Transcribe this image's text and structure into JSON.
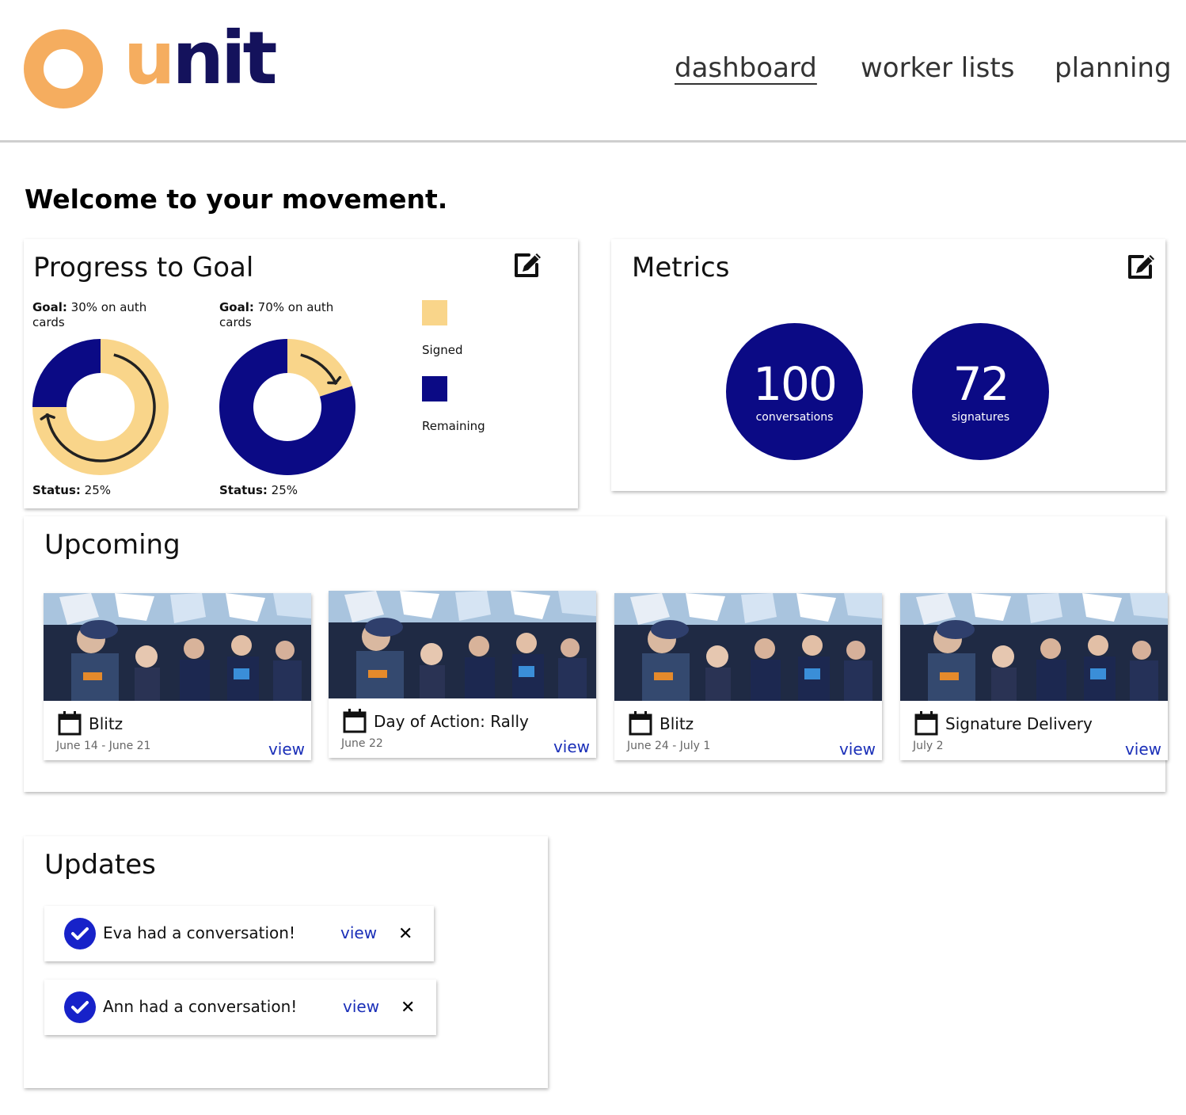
{
  "brand": {
    "name": "unit",
    "name_first": "u",
    "name_rest": "nit",
    "accent_color": "#f5ad5f",
    "navy_color": "#14125c"
  },
  "nav": {
    "items": [
      {
        "label": "dashboard",
        "active": true
      },
      {
        "label": "worker lists",
        "active": false
      },
      {
        "label": "planning",
        "active": false
      }
    ]
  },
  "welcome": "Welcome to your movement.",
  "progress": {
    "title": "Progress to Goal",
    "edit_icon": "edit-icon",
    "charts": [
      {
        "goal_label": "Goal:",
        "goal_text": "30% on auth",
        "goal_text2": "cards",
        "status_label": "Status:",
        "status_text": "25%",
        "signed_fraction": 0.75
      },
      {
        "goal_label": "Goal:",
        "goal_text": "70% on auth",
        "goal_text2": "cards",
        "status_label": "Status:",
        "status_text": "25%",
        "signed_fraction": 0.2
      }
    ],
    "legend": [
      {
        "label": "Signed",
        "color": "#f9d58a"
      },
      {
        "label": "Remaining",
        "color": "#0b0a85"
      }
    ]
  },
  "metrics": {
    "title": "Metrics",
    "edit_icon": "edit-icon",
    "items": [
      {
        "value": "100",
        "label": "conversations"
      },
      {
        "value": "72",
        "label": "signatures"
      }
    ]
  },
  "upcoming": {
    "title": "Upcoming",
    "events": [
      {
        "name": "Blitz",
        "date": "June 14 - June 21",
        "view_label": "view",
        "icon": "calendar-icon"
      },
      {
        "name": "Day of Action: Rally",
        "date": "June 22",
        "view_label": "view",
        "icon": "calendar-icon"
      },
      {
        "name": "Blitz",
        "date": "June 24 - July 1",
        "view_label": "view",
        "icon": "calendar-icon"
      },
      {
        "name": "Signature Delivery",
        "date": "July 2",
        "view_label": "view",
        "icon": "calendar-icon"
      }
    ]
  },
  "updates": {
    "title": "Updates",
    "items": [
      {
        "text": "Eva had a conversation!",
        "view_label": "view",
        "close": "✕",
        "icon": "check-circle-icon"
      },
      {
        "text": "Ann had a conversation!",
        "view_label": "view",
        "close": "✕",
        "icon": "check-circle-icon"
      }
    ]
  }
}
